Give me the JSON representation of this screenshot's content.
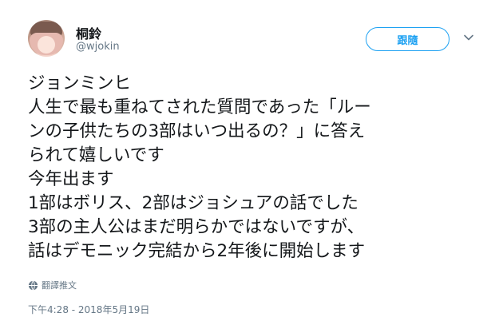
{
  "user": {
    "name": "桐鈴",
    "handle": "@wjokin"
  },
  "follow_label": "跟隨",
  "tweet": {
    "lines": [
      "ジョンミンヒ",
      "人生で最も重ねてされた質問であった「ルー",
      "ンの子供たちの3部はいつ出るの？」に答え",
      "られて嬉しいです",
      "今年出ます",
      "1部はボリス、2部はジョシュアの話でした",
      "3部の主人公はまだ明らかではないですが、",
      "話はデモニック完結から2年後に開始します"
    ]
  },
  "translate_label": "翻譯推文",
  "timestamp": "下午4:28 - 2018年5月19日",
  "colors": {
    "accent": "#1da1f2",
    "secondary_text": "#657786",
    "primary_text": "#14171a"
  },
  "icons": {
    "globe": "globe-icon",
    "chevron": "chevron-down-icon"
  }
}
